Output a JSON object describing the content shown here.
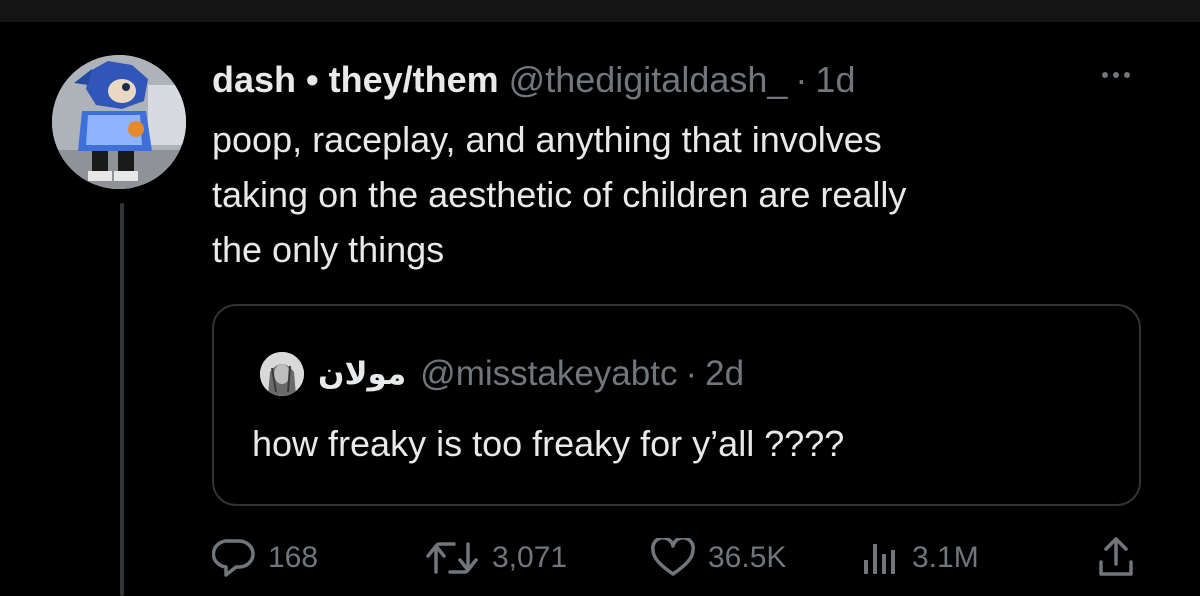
{
  "tweet": {
    "author": {
      "display_name": "dash • they/them",
      "handle": "@thedigitaldash_",
      "time": "1d",
      "avatar_icon": "sonic-costume-avatar"
    },
    "separator": "·",
    "text": "poop, raceplay, and anything that involves\ntaking on the aesthetic of children are really\nthe only things",
    "more_icon": "more-options-icon"
  },
  "quoted_tweet": {
    "display_name": "مولان",
    "handle": "@misstakeyabtc",
    "time": "2d",
    "text": "how freaky is too freaky for y’all ????",
    "avatar_icon": "quoted-user-avatar"
  },
  "actions": {
    "replies": {
      "icon": "reply-icon",
      "count": "168"
    },
    "retweets": {
      "icon": "retweet-icon",
      "count": "3,071"
    },
    "likes": {
      "icon": "heart-icon",
      "count": "36.5K"
    },
    "views": {
      "icon": "views-icon",
      "count": "3.1M"
    },
    "share": {
      "icon": "share-icon"
    }
  },
  "colors": {
    "background": "#000000",
    "text_primary": "#e7e9ea",
    "text_secondary": "#71767b",
    "border": "#2f3336"
  }
}
